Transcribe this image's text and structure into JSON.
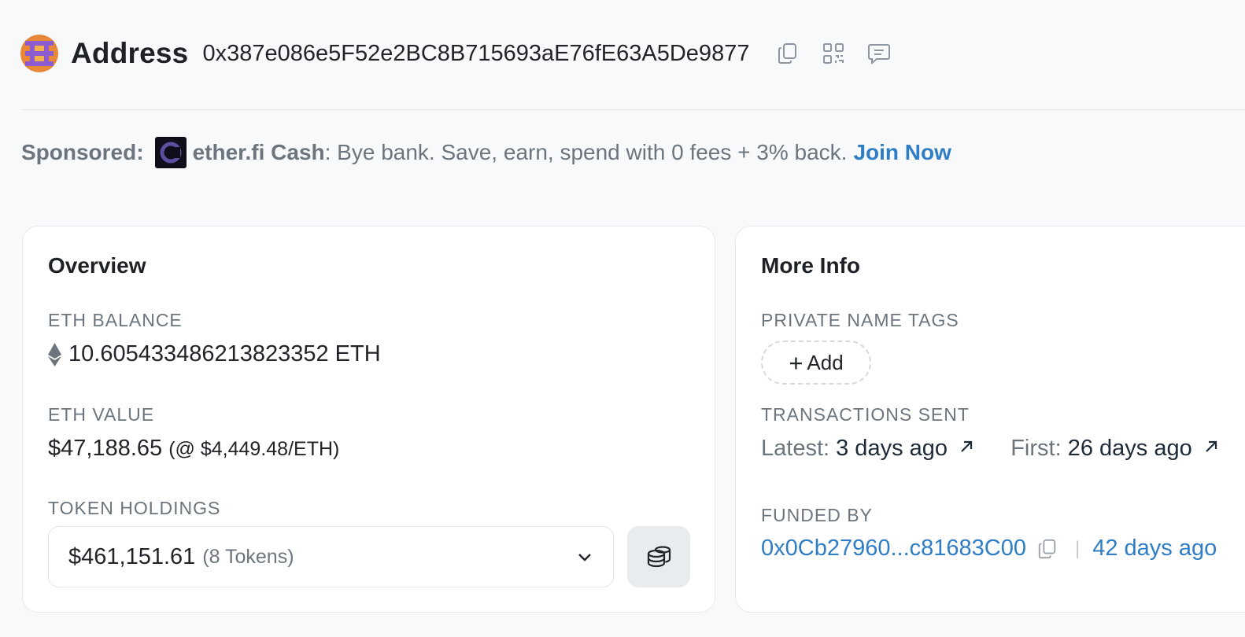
{
  "header": {
    "title": "Address",
    "address": "0x387e086e5F52e2BC8B715693aE76fE63A5De9877",
    "icons": [
      "copy-icon",
      "qr-code-icon",
      "comment-icon"
    ]
  },
  "sponsored": {
    "label": "Sponsored:",
    "brand": "ether.fi Cash",
    "text": ": Bye bank. Save, earn, spend with 0 fees + 3% back.",
    "cta": "Join Now"
  },
  "overview": {
    "title": "Overview",
    "eth_balance_label": "ETH BALANCE",
    "eth_balance": "10.605433486213823352 ETH",
    "eth_value_label": "ETH VALUE",
    "eth_value": "$47,188.65",
    "eth_price": "(@ $4,449.48/ETH)",
    "token_holdings_label": "TOKEN HOLDINGS",
    "token_value": "$461,151.61",
    "token_count": "(8 Tokens)"
  },
  "more_info": {
    "title": "More Info",
    "private_tags_label": "PRIVATE NAME TAGS",
    "add_label": "Add",
    "tx_sent_label": "TRANSACTIONS SENT",
    "latest_label": "Latest:",
    "latest_value": "3 days ago",
    "first_label": "First:",
    "first_value": "26 days ago",
    "funded_by_label": "FUNDED BY",
    "funded_by_address": "0x0Cb27960...c81683C00",
    "funded_by_age": "42 days ago",
    "separator": "|"
  },
  "colors": {
    "link": "#2f7dc4",
    "muted": "#6c757d",
    "background": "#f8f9fb",
    "card": "#ffffff"
  }
}
